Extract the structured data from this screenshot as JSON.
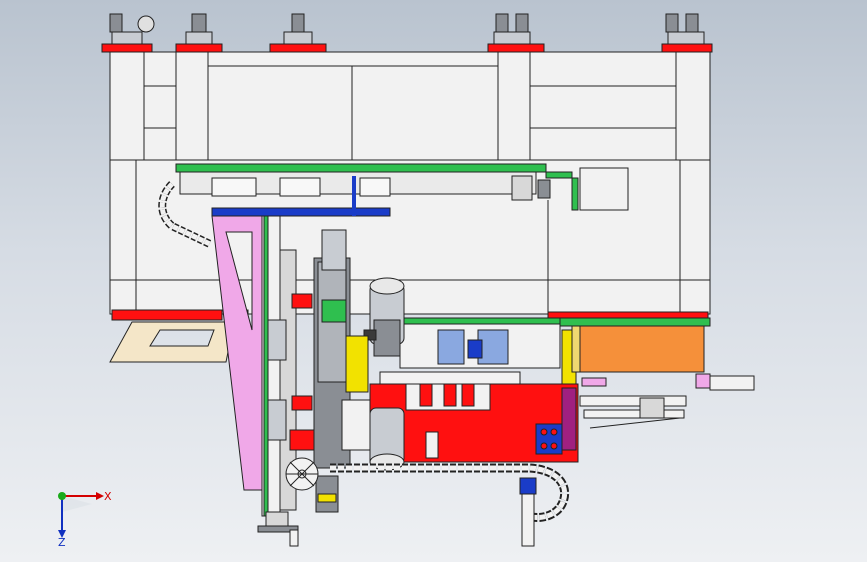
{
  "triad": {
    "x_label": "X",
    "z_label": "Z",
    "colors": {
      "x": "#d40000",
      "y": "#1aaa1a",
      "z": "#1030c0"
    }
  },
  "palette": {
    "frame": "#f2f2f2",
    "line": "#222222",
    "red": "#ff1010",
    "blue": "#1a3cc8",
    "pink": "#f0a8e8",
    "orange": "#f5903a",
    "green": "#2fbf4f",
    "yellow": "#f2e200",
    "tan": "#f4e6c8",
    "gray": "#8a8e94",
    "silver": "#c8ccd2",
    "purple": "#8a6cd0"
  }
}
